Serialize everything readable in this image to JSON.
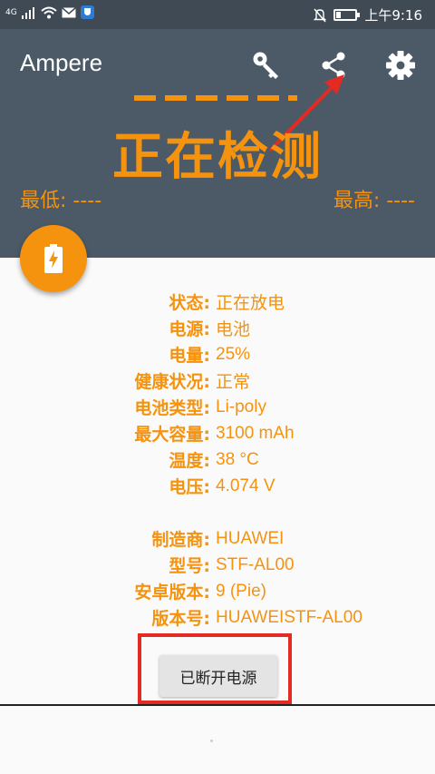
{
  "status_bar": {
    "left_text": "4G",
    "time": "上午9:16",
    "battery_level": 0.25
  },
  "header": {
    "app_title": "Ampere",
    "status_text": "正在检测",
    "min_text": "最低: ----",
    "max_text": "最高: ----",
    "accent_color": "#f5930f",
    "bg_color": "#4b5a66"
  },
  "info": {
    "rows": [
      {
        "label": "状态:",
        "value": "正在放电"
      },
      {
        "label": "电源:",
        "value": "电池"
      },
      {
        "label": "电量:",
        "value": "25%"
      },
      {
        "label": "健康状况:",
        "value": "正常"
      },
      {
        "label": "电池类型:",
        "value": "Li-poly"
      },
      {
        "label": "最大容量:",
        "value": "3100 mAh"
      },
      {
        "label": "温度:",
        "value": "38 °C"
      },
      {
        "label": "电压:",
        "value": "4.074 V"
      }
    ],
    "device_rows": [
      {
        "label": "制造商:",
        "value": "HUAWEI"
      },
      {
        "label": "型号:",
        "value": "STF-AL00"
      },
      {
        "label": "安卓版本:",
        "value": "9 (Pie)"
      },
      {
        "label": "版本号:",
        "value": "HUAWEISTF-AL00"
      }
    ]
  },
  "button": {
    "label": "已断开电源"
  },
  "icons": {
    "key": "key-icon",
    "share": "share-icon",
    "settings": "gear-icon",
    "fab": "battery-charging-icon"
  }
}
